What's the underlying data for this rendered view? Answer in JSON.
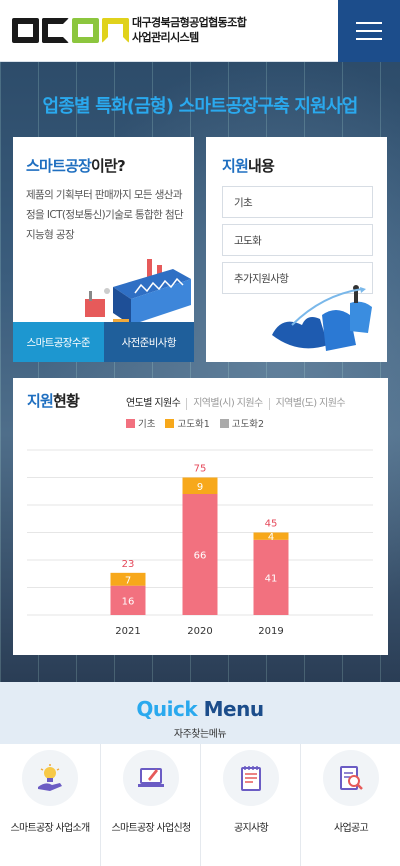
{
  "header": {
    "org_line1": "대구경북금형공업협동조합",
    "org_line2": "사업관리시스템",
    "logo_text": "DGDM"
  },
  "hero": {
    "title": "업종별 특화(금형) 스마트공장구축 지원사업"
  },
  "smart_factory": {
    "title_highlight": "스마트공장",
    "title_rest": "이란?",
    "description": "제품의 기획부터 판매까지 모든 생산과정을 ICT(정보통신)기술로 통합한 첨단 지능형 공장",
    "buttons": [
      "스마트공장수준",
      "사전준비사항"
    ]
  },
  "support": {
    "title_highlight": "지원",
    "title_rest": "내용",
    "items": [
      "기초",
      "고도화",
      "추가지원사항"
    ]
  },
  "status": {
    "title_highlight": "지원",
    "title_rest": "현황",
    "tabs": [
      "연도별 지원수",
      "지역별(시) 지원수",
      "지역별(도) 지원수"
    ],
    "legend": [
      {
        "label": "기초",
        "color": "#f2717f"
      },
      {
        "label": "고도화1",
        "color": "#f7a81b"
      },
      {
        "label": "고도화2",
        "color": "#aaaaaa"
      }
    ]
  },
  "chart_data": {
    "type": "bar",
    "stacked": true,
    "categories": [
      "2021",
      "2020",
      "2019"
    ],
    "series": [
      {
        "name": "기초",
        "values": [
          16,
          66,
          41
        ],
        "color": "#f2717f"
      },
      {
        "name": "고도화1",
        "values": [
          7,
          9,
          4
        ],
        "color": "#f7a81b"
      },
      {
        "name": "고도화2",
        "values": [
          0,
          0,
          0
        ],
        "color": "#aaaaaa"
      }
    ],
    "totals": [
      23,
      75,
      45
    ],
    "ylim": [
      0,
      90
    ],
    "grid": true
  },
  "quick_menu": {
    "title_a": "Quick",
    "title_b": "Menu",
    "subtitle": "자주찾는메뉴",
    "items": [
      {
        "label": "스마트공장 사업소개",
        "icon": "lightbulb-hand-icon"
      },
      {
        "label": "스마트공장 사업신청",
        "icon": "laptop-pen-icon"
      },
      {
        "label": "공지사항",
        "icon": "notepad-icon"
      },
      {
        "label": "사업공고",
        "icon": "document-search-icon"
      }
    ]
  }
}
